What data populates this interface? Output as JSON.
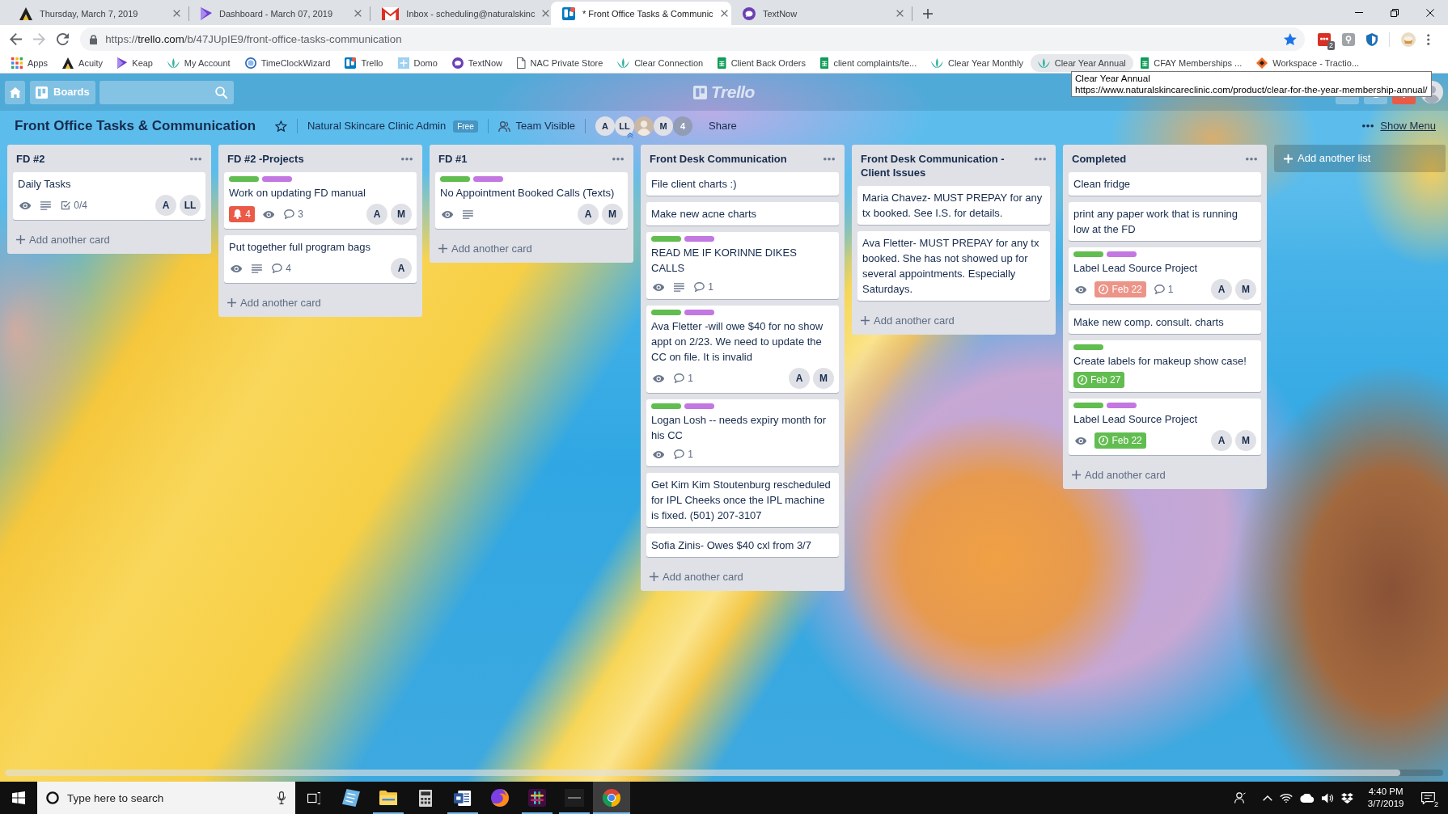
{
  "browser": {
    "tabs": [
      {
        "title": "Thursday, March 7, 2019",
        "selected": false
      },
      {
        "title": "Dashboard - March 07, 2019",
        "selected": false
      },
      {
        "title": "Inbox - scheduling@naturalskinc",
        "selected": false
      },
      {
        "title": "* Front Office Tasks & Communic",
        "selected": true
      },
      {
        "title": "TextNow",
        "selected": false
      }
    ],
    "address": {
      "scheme": "https://",
      "host": "trello.com",
      "path": "/b/47JUpIE9/front-office-tasks-communication"
    },
    "extension_badge": "2",
    "bookmarks": [
      {
        "label": "Apps",
        "hovered": false
      },
      {
        "label": "Acuity",
        "hovered": false
      },
      {
        "label": "Keap",
        "hovered": false
      },
      {
        "label": "My Account",
        "hovered": false
      },
      {
        "label": "TimeClockWizard",
        "hovered": false
      },
      {
        "label": "Trello",
        "hovered": false
      },
      {
        "label": "Domo",
        "hovered": false
      },
      {
        "label": "TextNow",
        "hovered": false
      },
      {
        "label": "NAC Private Store",
        "hovered": false
      },
      {
        "label": "Clear Connection",
        "hovered": false
      },
      {
        "label": "Client Back Orders",
        "hovered": false
      },
      {
        "label": "client complaints/te...",
        "hovered": false
      },
      {
        "label": "Clear Year Monthly",
        "hovered": false
      },
      {
        "label": "Clear Year Annual",
        "hovered": true
      },
      {
        "label": "CFAY Memberships ...",
        "hovered": false
      },
      {
        "label": "Workspace - Tractio...",
        "hovered": false
      }
    ],
    "tooltip": {
      "title": "Clear Year Annual",
      "url": "https://www.naturalskincareclinic.com/product/clear-for-the-year-membership-annual/"
    }
  },
  "header": {
    "boards_button": "Boards",
    "logo": "Trello"
  },
  "board": {
    "title": "Front Office Tasks & Communication",
    "team": "Natural Skincare Clinic Admin",
    "plan": "Free",
    "visibility": "Team Visible",
    "members": [
      {
        "kind": "initials",
        "initials": "A",
        "admin": false
      },
      {
        "kind": "initials",
        "initials": "LL",
        "admin": true
      },
      {
        "kind": "photo",
        "admin": false
      },
      {
        "kind": "initials",
        "initials": "M",
        "admin": false
      }
    ],
    "more_members": "4",
    "share": "Share",
    "menu": "Show Menu"
  },
  "lists": [
    {
      "title": "FD #2",
      "cards": [
        {
          "title": "Daily Tasks",
          "badges": [
            {
              "kind": "watch"
            },
            {
              "kind": "description"
            },
            {
              "kind": "checklist",
              "text": "0/4"
            }
          ],
          "members": [
            "A",
            "LL"
          ]
        }
      ],
      "add_card": "Add another card"
    },
    {
      "title": "FD #2 -Projects",
      "cards": [
        {
          "labels": [
            {
              "color": "#61bd4f"
            },
            {
              "color": "#c377e0"
            }
          ],
          "title": "Work on updating FD manual",
          "badges": [
            {
              "kind": "notifications",
              "text": "4"
            },
            {
              "kind": "watch"
            },
            {
              "kind": "comments",
              "text": "3"
            }
          ],
          "members": [
            "A",
            "M"
          ]
        },
        {
          "title": "Put together full program bags",
          "badges": [
            {
              "kind": "watch"
            },
            {
              "kind": "description"
            },
            {
              "kind": "comments",
              "text": "4"
            }
          ],
          "members": [
            "A"
          ]
        }
      ],
      "add_card": "Add another card"
    },
    {
      "title": "FD #1",
      "cards": [
        {
          "labels": [
            {
              "color": "#61bd4f"
            },
            {
              "color": "#c377e0"
            }
          ],
          "title": "No Appointment Booked Calls (Texts)",
          "badges": [
            {
              "kind": "watch"
            },
            {
              "kind": "description"
            }
          ],
          "members": [
            "A",
            "M"
          ]
        }
      ],
      "add_card": "Add another card"
    },
    {
      "title": "Front Desk Communication",
      "cards": [
        {
          "title": "File client charts :)"
        },
        {
          "title": "Make new acne charts"
        },
        {
          "labels": [
            {
              "color": "#61bd4f"
            },
            {
              "color": "#c377e0"
            }
          ],
          "title": "READ ME IF KORINNE DIKES CALLS",
          "badges": [
            {
              "kind": "watch"
            },
            {
              "kind": "description"
            },
            {
              "kind": "comments",
              "text": "1"
            }
          ]
        },
        {
          "labels": [
            {
              "color": "#61bd4f"
            },
            {
              "color": "#c377e0"
            }
          ],
          "title": "Ava Fletter -will owe $40 for no show appt on 2/23. We need to update the CC on file. It is invalid",
          "badges": [
            {
              "kind": "watch"
            },
            {
              "kind": "comments",
              "text": "1"
            }
          ],
          "members": [
            "A",
            "M"
          ]
        },
        {
          "labels": [
            {
              "color": "#61bd4f"
            },
            {
              "color": "#c377e0"
            }
          ],
          "title": "Logan Losh -- needs expiry month for his CC",
          "badges": [
            {
              "kind": "watch"
            },
            {
              "kind": "comments",
              "text": "1"
            }
          ]
        },
        {
          "title": "Get Kim Kim Stoutenburg rescheduled for IPL Cheeks once the IPL machine is fixed. (501) 207-3107"
        },
        {
          "title": "Sofia Zinis- Owes $40 cxl from 3/7"
        }
      ],
      "add_card": "Add another card"
    },
    {
      "title": "Front Desk Communication - Client Issues",
      "cards": [
        {
          "title": "Maria Chavez- MUST PREPAY for any tx booked. See I.S. for details."
        },
        {
          "title": "Ava Fletter- MUST PREPAY for any tx booked. She has not showed up for several appointments. Especially Saturdays."
        }
      ],
      "add_card": "Add another card"
    },
    {
      "title": "Completed",
      "cards": [
        {
          "title": "Clean fridge"
        },
        {
          "title": "print any paper work that is running low at the FD"
        },
        {
          "labels": [
            {
              "color": "#61bd4f"
            },
            {
              "color": "#c377e0"
            }
          ],
          "title": "Label Lead Source Project",
          "badges": [
            {
              "kind": "watch"
            },
            {
              "kind": "due",
              "text": "Feb 22",
              "complete": false
            },
            {
              "kind": "comments",
              "text": "1"
            }
          ],
          "members": [
            "A",
            "M"
          ]
        },
        {
          "title": "Make new comp. consult. charts"
        },
        {
          "labels": [
            {
              "color": "#61bd4f"
            }
          ],
          "title": "Create labels for makeup show case!",
          "badges": [
            {
              "kind": "due",
              "text": "Feb 27",
              "complete": true
            }
          ]
        },
        {
          "labels": [
            {
              "color": "#61bd4f"
            },
            {
              "color": "#c377e0"
            }
          ],
          "title": "Label Lead Source Project",
          "badges": [
            {
              "kind": "watch"
            },
            {
              "kind": "due",
              "text": "Feb 22",
              "complete": true
            }
          ],
          "members": [
            "A",
            "M"
          ]
        }
      ],
      "add_card": "Add another card"
    }
  ],
  "add_list": "Add another list",
  "taskbar": {
    "search_placeholder": "Type here to search",
    "apps": [
      {
        "running": false,
        "selected": false
      },
      {
        "running": true,
        "selected": false
      },
      {
        "running": false,
        "selected": false
      },
      {
        "running": true,
        "selected": false
      },
      {
        "running": false,
        "selected": false
      },
      {
        "running": true,
        "selected": false
      },
      {
        "running": true,
        "selected": false
      },
      {
        "running": true,
        "selected": true
      }
    ],
    "time": "4:40 PM",
    "date": "3/7/2019",
    "notifications": "2"
  }
}
